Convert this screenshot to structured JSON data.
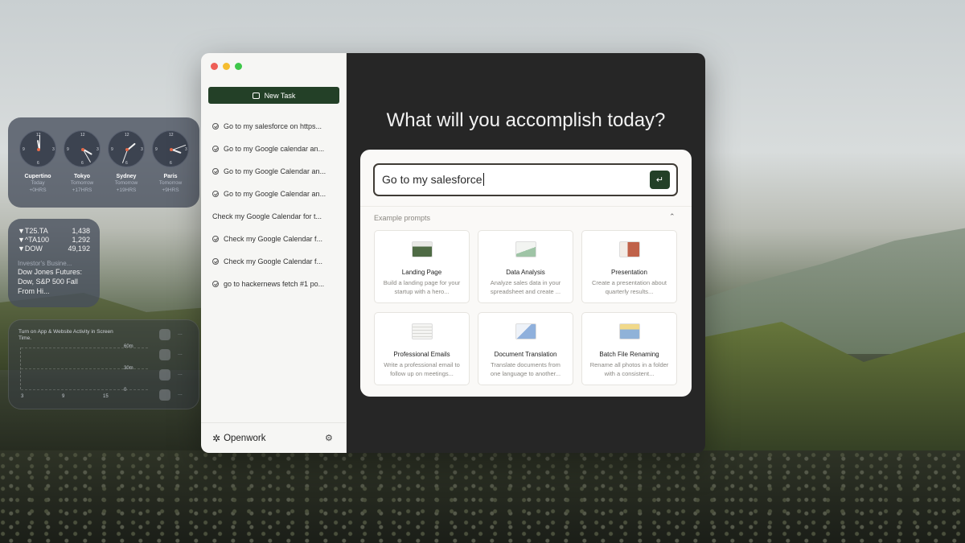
{
  "desktop": {
    "clocks": [
      {
        "city": "Cupertino",
        "day": "Today",
        "offset": "+0HRS",
        "hour_deg": 170,
        "min_deg": 0
      },
      {
        "city": "Tokyo",
        "day": "Tomorrow",
        "offset": "+17HRS",
        "hour_deg": 135,
        "min_deg": -30
      },
      {
        "city": "Sydney",
        "day": "Tomorrow",
        "offset": "+19HRS",
        "hour_deg": 120,
        "min_deg": 20
      },
      {
        "city": "Paris",
        "day": "Tomorrow",
        "offset": "+9HRS",
        "hour_deg": 60,
        "min_deg": -80
      }
    ],
    "stocks": [
      {
        "symbol": "▼T25.TA",
        "value": "1,438"
      },
      {
        "symbol": "▼^TA100",
        "value": "1,292"
      },
      {
        "symbol": "▼DOW",
        "value": "49,192"
      }
    ],
    "news_source": "Investor's Busine...",
    "news_headline": "Dow Jones Futures: Dow, S&P 500 Fall From Hi...",
    "screen_time": {
      "text": "Turn on App & Website Activity in Screen Time.",
      "y_labels": [
        "60m",
        "30m",
        "0"
      ],
      "x_labels": [
        "3",
        "9",
        "15"
      ],
      "dots": "..."
    }
  },
  "app": {
    "new_task_label": "New Task",
    "tasks": [
      {
        "label": "Go to my salesforce on https...",
        "check": true
      },
      {
        "label": "Go to my Google calendar an...",
        "check": true
      },
      {
        "label": "Go to my Google Calendar an...",
        "check": true
      },
      {
        "label": "Go to my Google Calendar an...",
        "check": true
      },
      {
        "label": "Check my Google Calendar for t...",
        "check": false
      },
      {
        "label": "Check my Google Calendar f...",
        "check": true
      },
      {
        "label": "Check my Google Calendar f...",
        "check": true
      },
      {
        "label": "go to hackernews fetch #1 po...",
        "check": true
      }
    ],
    "brand": "Openwork",
    "brand_icon": "openwork-logo-icon",
    "settings_icon": "gear-icon",
    "headline": "What will you accomplish today?",
    "input_value": "Go to my salesforce",
    "send_icon": "↵",
    "examples_label": "Example prompts",
    "examples": [
      {
        "title": "Landing Page",
        "desc": "Build a landing page for your startup with a hero..."
      },
      {
        "title": "Data Analysis",
        "desc": "Analyze sales data in your spreadsheet and create ..."
      },
      {
        "title": "Presentation",
        "desc": "Create a presentation about quarterly results..."
      },
      {
        "title": "Professional Emails",
        "desc": "Write a professional email to follow up on meetings..."
      },
      {
        "title": "Document Translation",
        "desc": "Translate documents from one language to another..."
      },
      {
        "title": "Batch File Renaming",
        "desc": "Rename all photos in a folder with a consistent..."
      }
    ],
    "colors": {
      "accent": "#234027",
      "main_bg": "#262626",
      "sidebar_bg": "#f6f6f4"
    }
  }
}
